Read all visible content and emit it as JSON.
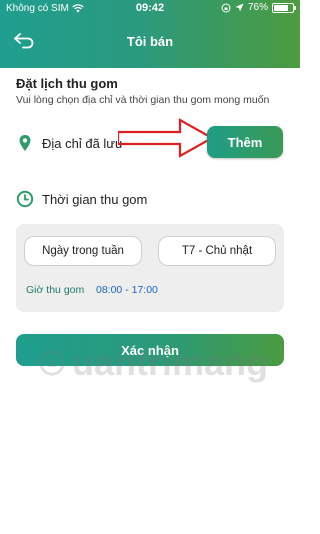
{
  "status_bar": {
    "carrier": "Không có SIM",
    "time": "09:42",
    "battery": "76%",
    "battery_level": 0.76
  },
  "header": {
    "title": "Tôi bán",
    "back_icon": "back-arrow-icon"
  },
  "schedule": {
    "title": "Đặt lịch thu gom",
    "subtitle": "Vui lòng chọn địa chỉ và thời gian thu gom mong muốn"
  },
  "address": {
    "label": "Địa chỉ đã lưu",
    "icon": "location-pin-icon",
    "add_button": "Thêm"
  },
  "collection_time": {
    "label": "Thời gian thu gom",
    "icon": "clock-icon",
    "days_chip": "Ngày trong tuần",
    "range_chip": "T7 - Chủ nhật",
    "hours_label": "Giờ thu gom",
    "hours_value": "08:00 - 17:00"
  },
  "actions": {
    "confirm": "Xác nhận"
  },
  "watermark": {
    "text": "uantrimang",
    "icon": "quantrimang-logo"
  },
  "colors": {
    "accent_green": "#2e9c6a",
    "link_blue": "#1e63b8",
    "annotation_red": "#e02020"
  }
}
